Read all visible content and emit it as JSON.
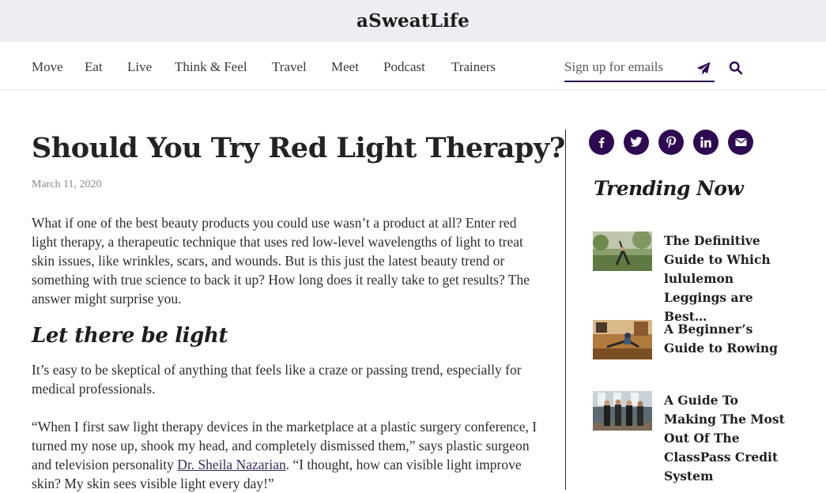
{
  "header": {
    "logo": "aSweatLife"
  },
  "nav": {
    "items": [
      {
        "label": "Move"
      },
      {
        "label": "Eat"
      },
      {
        "label": "Live"
      },
      {
        "label": "Think & Feel"
      },
      {
        "label": "Travel"
      },
      {
        "label": "Meet"
      },
      {
        "label": "Podcast"
      },
      {
        "label": "Trainers"
      }
    ],
    "signup_placeholder": "Sign up for emails",
    "send_icon": "paper-plane-icon",
    "search_icon": "search-icon"
  },
  "article": {
    "title": "Should You Try Red Light Therapy?",
    "date": "March 11, 2020",
    "paragraph1": "What if one of the best beauty products you could use wasn’t a product at all? Enter red light therapy, a therapeutic technique that uses red low-level wavelengths of light to treat skin issues, like wrinkles, scars, and wounds. But is this just the latest beauty trend or something with true science to back it up? How long does it really take to get results? The answer might surprise you.",
    "subheading": "Let there be light",
    "paragraph2": "It’s easy to be skeptical of anything that feels like a craze or passing trend, especially for medical professionals.",
    "paragraph3_before": "“When I first saw light therapy devices in the marketplace at a plastic surgery conference, I turned my nose up, shook my head, and completely dismissed them,” says plastic surgeon and television personality ",
    "paragraph3_link": "Dr. Sheila Nazarian",
    "paragraph3_after": ". “I thought, how can visible light improve skin? My skin sees visible light every day!”"
  },
  "sidebar": {
    "social": [
      "facebook-icon",
      "twitter-icon",
      "pinterest-icon",
      "linkedin-icon",
      "email-icon"
    ],
    "trending_title": "Trending Now",
    "trending": [
      {
        "title": "The Definitive Guide to Which lululemon Leggings are Best…"
      },
      {
        "title": "A Beginner’s Guide to Rowing"
      },
      {
        "title": "A Guide To Making The Most Out Of The ClassPass Credit System"
      }
    ]
  },
  "colors": {
    "accent": "#2d0a52",
    "topbar_bg": "#efedf3"
  }
}
